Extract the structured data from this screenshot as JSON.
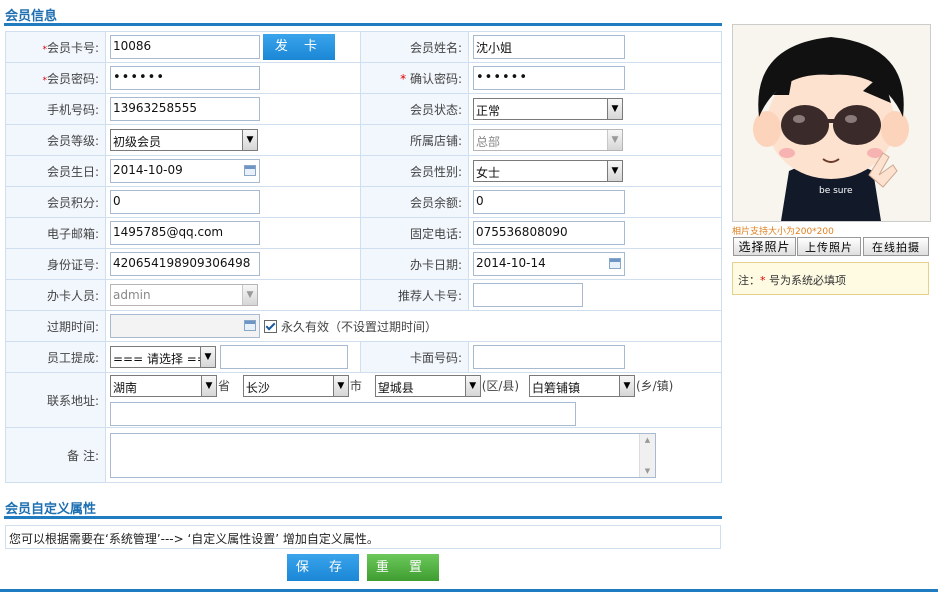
{
  "section1_title": "会员信息",
  "section2_title": "会员自定义属性",
  "fields": {
    "card_no": {
      "label": "会员卡号:",
      "value": "10086"
    },
    "issue_btn": "发 卡",
    "name": {
      "label": "会员姓名:",
      "value": "沈小姐"
    },
    "password": {
      "label": "会员密码:",
      "value": "••••••"
    },
    "confirm": {
      "label": "确认密码:",
      "value": "••••••"
    },
    "mobile": {
      "label": "手机号码:",
      "value": "13963258555"
    },
    "status": {
      "label": "会员状态:",
      "value": "正常"
    },
    "level": {
      "label": "会员等级:",
      "value": "初级会员"
    },
    "store": {
      "label": "所属店铺:",
      "value": "总部"
    },
    "birthday": {
      "label": "会员生日:",
      "value": "2014-10-09"
    },
    "gender": {
      "label": "会员性别:",
      "value": "女士"
    },
    "points": {
      "label": "会员积分:",
      "value": "0"
    },
    "balance": {
      "label": "会员余额:",
      "value": "0"
    },
    "email": {
      "label": "电子邮箱:",
      "value": "1495785@qq.com"
    },
    "phone": {
      "label": "固定电话:",
      "value": "075536808090"
    },
    "idcard": {
      "label": "身份证号:",
      "value": "420654198909306498"
    },
    "issue_date": {
      "label": "办卡日期:",
      "value": "2014-10-14"
    },
    "operator": {
      "label": "办卡人员:",
      "value": "admin"
    },
    "referrer": {
      "label": "推荐人卡号:",
      "value": ""
    },
    "expire": {
      "label": "过期时间:",
      "value": "",
      "forever_label": "永久有效（不设置过期时间）"
    },
    "commission": {
      "label": "员工提成:",
      "select": "=== 请选择 ===",
      "value": ""
    },
    "face_no": {
      "label": "卡面号码:",
      "value": ""
    },
    "address": {
      "label": "联系地址:",
      "province": "湖南",
      "province_unit": "省",
      "city": "长沙",
      "city_unit": "市",
      "county": "望城县",
      "county_unit": "(区/县)",
      "town": "白箬铺镇",
      "town_unit": "(乡/镇)",
      "detail": ""
    },
    "remark": {
      "label": "备 注:",
      "value": ""
    }
  },
  "photo": {
    "hint": "相片支持大小为200*200",
    "select_btn": "选择照片",
    "upload_btn": "上传照片",
    "online_btn": "在线拍摄",
    "note_prefix": "注：",
    "note_star": "*",
    "note_text": "号为系统必填项"
  },
  "custom_info": "您可以根据需要在‘系统管理’---> ‘自定义属性设置’ 增加自定义属性。",
  "save_btn": "保 存",
  "reset_btn": "重 置",
  "colors": {
    "accent": "#1f7cc1",
    "save": "#1a86d5",
    "reset": "#4cae3c"
  }
}
